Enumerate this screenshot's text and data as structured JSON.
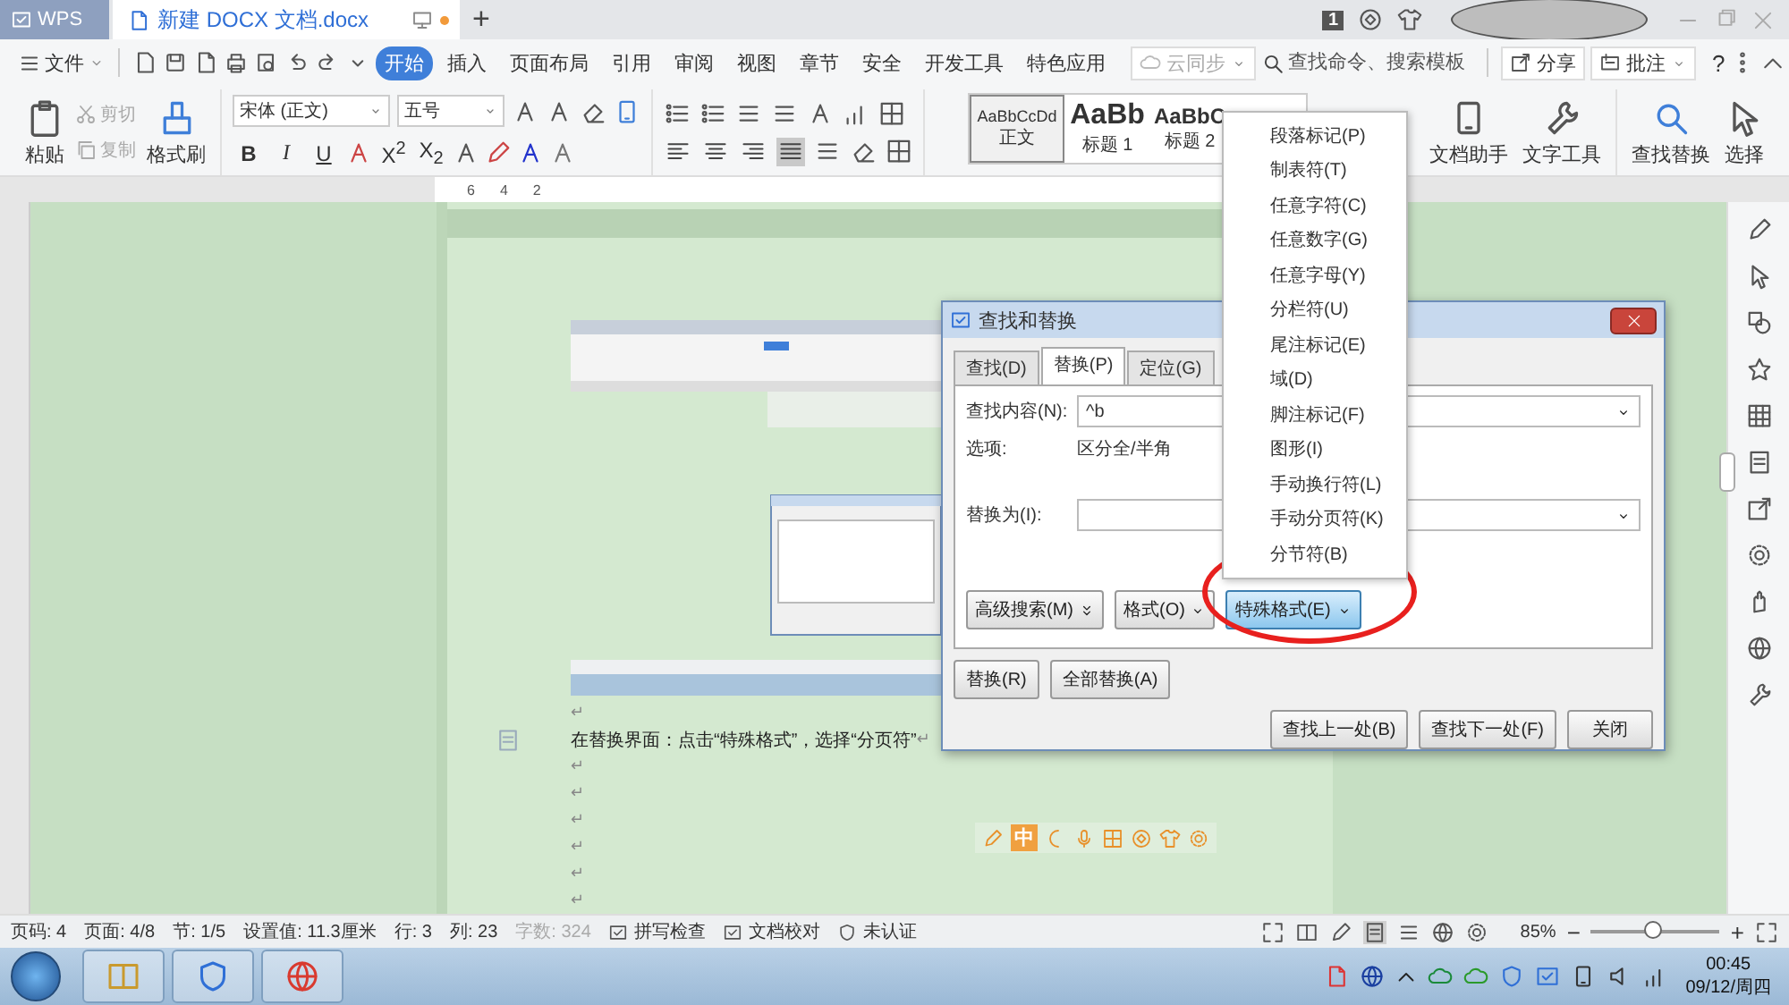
{
  "title_bar": {
    "app_tab": "WPS",
    "doc_tab": "新建 DOCX 文档.docx",
    "new_tab": "+",
    "badge": "1"
  },
  "menu": {
    "file": "文件",
    "tabs": [
      {
        "label": "开始",
        "selected": true
      },
      {
        "label": "插入",
        "selected": false
      },
      {
        "label": "页面布局",
        "selected": false
      },
      {
        "label": "引用",
        "selected": false
      },
      {
        "label": "审阅",
        "selected": false
      },
      {
        "label": "视图",
        "selected": false
      },
      {
        "label": "章节",
        "selected": false
      },
      {
        "label": "安全",
        "selected": false
      },
      {
        "label": "开发工具",
        "selected": false
      },
      {
        "label": "特色应用",
        "selected": false
      }
    ],
    "cloud_sync": {
      "label": "云同步",
      "disabled": true
    },
    "search": {
      "placeholder": "查找命令、搜索模板"
    },
    "share": "分享",
    "comment": "批注",
    "help": "?"
  },
  "ribbon": {
    "paste": "粘贴",
    "cut": {
      "label": "剪切",
      "disabled": true
    },
    "copy": {
      "label": "复制",
      "disabled": true
    },
    "format_painter": "格式刷",
    "font": "宋体 (正文)",
    "size": "五号",
    "format_buttons": [
      "B",
      "I",
      "U"
    ],
    "superscript": "X$^{2}$",
    "subscript": "X$_{2}$",
    "alignment": [
      {
        "selected": false
      },
      {
        "selected": false
      },
      {
        "selected": false
      },
      {
        "selected": true
      }
    ],
    "styles": [
      {
        "preview": "AaBbCcDd",
        "name": "正文",
        "selected": true
      },
      {
        "preview": "AaBb",
        "name": "标题 1",
        "selected": false
      },
      {
        "preview": "AaBbC",
        "name": "标题 2",
        "selected": false
      }
    ],
    "tools": [
      "文档助手",
      "文字工具",
      "查找替换",
      "选择"
    ]
  },
  "ruler": {
    "labels": [
      "6",
      "4",
      "2"
    ]
  },
  "document": {
    "lines": [
      {
        "kind": "image"
      },
      {
        "kind": "empty",
        "mark": "↵"
      },
      {
        "kind": "text",
        "text": "在替换界面：点击“特殊格式”，选择“分页符”",
        "mark": "↵"
      },
      {
        "kind": "empty",
        "mark": "↵"
      },
      {
        "kind": "empty",
        "mark": "↵"
      },
      {
        "kind": "empty",
        "mark": "↵"
      },
      {
        "kind": "empty",
        "mark": "↵"
      },
      {
        "kind": "empty",
        "mark": "↵"
      },
      {
        "kind": "empty",
        "mark": "↵"
      }
    ]
  },
  "floating_toolbar": {
    "label": "中"
  },
  "dialog": {
    "title": "查找和替换",
    "tabs": [
      {
        "label": "查找(D)",
        "selected": false
      },
      {
        "label": "替换(P)",
        "selected": true
      },
      {
        "label": "定位(G)",
        "selected": false
      }
    ],
    "find_label": "查找内容(N):",
    "find_value": "^b",
    "options_label": "选项:",
    "options_value": "区分全/半角",
    "replace_label": "替换为(I):",
    "buttons": [
      {
        "label": "高级搜索(M)",
        "kind": "more",
        "pressed": false
      },
      {
        "label": "格式(O)",
        "kind": "menu",
        "pressed": false
      },
      {
        "label": "特殊格式(E)",
        "kind": "menu",
        "pressed": true
      }
    ],
    "action_buttons": [
      "替换(R)",
      "全部替换(A)"
    ],
    "nav_buttons": [
      "查找上一处(B)",
      "查找下一处(F)",
      "关闭"
    ]
  },
  "special_menu": {
    "items": [
      "段落标记(P)",
      "制表符(T)",
      "任意字符(C)",
      "任意数字(G)",
      "任意字母(Y)",
      "分栏符(U)",
      "尾注标记(E)",
      "域(D)",
      "脚注标记(F)",
      "图形(I)",
      "手动换行符(L)",
      "手动分页符(K)",
      "分节符(B)"
    ]
  },
  "status_bar": {
    "items": [
      {
        "text": "页码: 4",
        "disabled": false
      },
      {
        "text": "页面: 4/8",
        "disabled": false
      },
      {
        "text": "节: 1/5",
        "disabled": false
      },
      {
        "text": "设置值: 11.3厘米",
        "disabled": false
      },
      {
        "text": "行: 3",
        "disabled": false
      },
      {
        "text": "列: 23",
        "disabled": false
      },
      {
        "text": "字数: 324",
        "disabled": true
      }
    ],
    "tools": [
      "拼写检查",
      "文档校对",
      "未认证"
    ],
    "zoom": "85%",
    "zoom_out": "−",
    "zoom_in": "+",
    "level": 0.48
  },
  "taskbar": {
    "time": "00:45",
    "date": "09/12/周四"
  }
}
